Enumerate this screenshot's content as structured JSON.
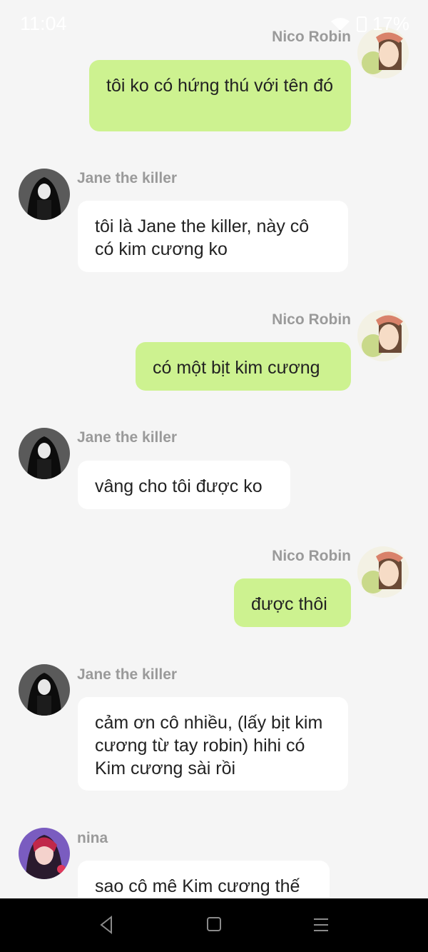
{
  "status_bar": {
    "time": "11:04",
    "battery": "17%"
  },
  "messages": [
    {
      "sender": "Nico Robin",
      "direction": "outgoing",
      "text": "tôi ko có hứng thú với tên đó"
    },
    {
      "sender": "Jane the killer",
      "direction": "incoming",
      "text": "tôi là Jane the killer, này cô có kim cương ko"
    },
    {
      "sender": "Nico Robin",
      "direction": "outgoing",
      "text": "có một bịt kim cương"
    },
    {
      "sender": "Jane the killer",
      "direction": "incoming",
      "text": "vâng cho tôi được ko"
    },
    {
      "sender": "Nico Robin",
      "direction": "outgoing",
      "text": "được thôi"
    },
    {
      "sender": "Jane the killer",
      "direction": "incoming",
      "text": "cảm ơn cô nhiều, (lấy bịt kim cương từ tay robin) hihi có Kim cương sài rồi"
    },
    {
      "sender": "nina",
      "direction": "incoming",
      "text": "sao cô mê Kim cương thế"
    }
  ],
  "nav": {
    "back": "back-icon",
    "home": "home-icon",
    "menu": "menu-icon"
  },
  "colors": {
    "outgoing_bubble": "#cdf290",
    "incoming_bubble": "#ffffff",
    "background": "#f5f5f5",
    "name": "#9a9a9a"
  }
}
